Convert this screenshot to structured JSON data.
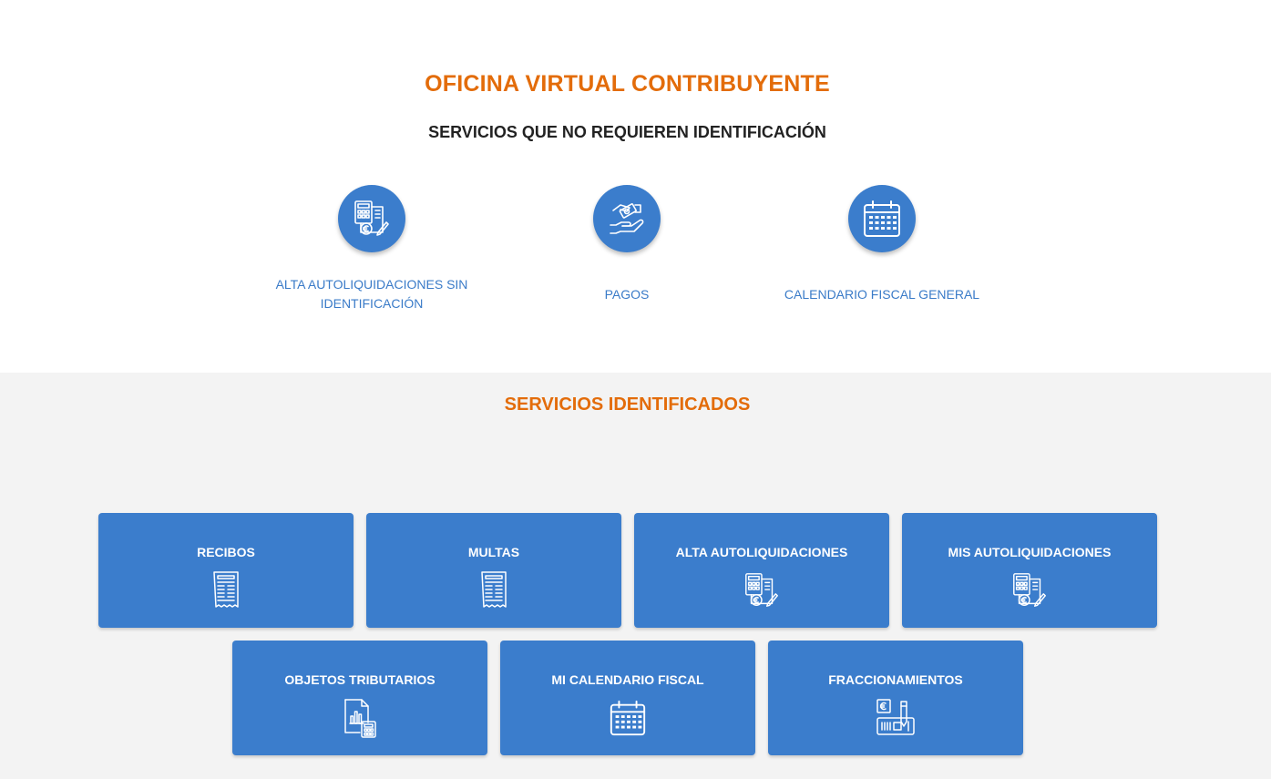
{
  "header": {
    "title": "OFICINA VIRTUAL CONTRIBUYENTE",
    "subtitle": "SERVICIOS QUE NO REQUIEREN IDENTIFICACIÓN"
  },
  "public_services": [
    {
      "label": "ALTA AUTOLIQUIDACIONES SIN IDENTIFICACIÓN",
      "icon": "calculator-document-euro-icon"
    },
    {
      "label": "PAGOS",
      "icon": "hand-money-icon"
    },
    {
      "label": "CALENDARIO FISCAL GENERAL",
      "icon": "calendar-icon"
    }
  ],
  "identified": {
    "title": "SERVICIOS IDENTIFICADOS",
    "cards": [
      {
        "label": "RECIBOS",
        "icon": "receipt-icon"
      },
      {
        "label": "MULTAS",
        "icon": "receipt-icon"
      },
      {
        "label": "ALTA AUTOLIQUIDACIONES",
        "icon": "calculator-document-euro-icon"
      },
      {
        "label": "MIS AUTOLIQUIDACIONES",
        "icon": "calculator-document-euro-icon"
      },
      {
        "label": "OBJETOS TRIBUTARIOS",
        "icon": "report-calculator-icon"
      },
      {
        "label": "MI CALENDARIO FISCAL",
        "icon": "calendar-icon"
      },
      {
        "label": "FRACCIONAMIENTOS",
        "icon": "installment-payment-icon"
      }
    ]
  },
  "colors": {
    "accent_orange": "#e36c0a",
    "primary_blue": "#3b7dcc",
    "link_blue": "#3a7bc8",
    "section_background": "#f3f3f3"
  }
}
